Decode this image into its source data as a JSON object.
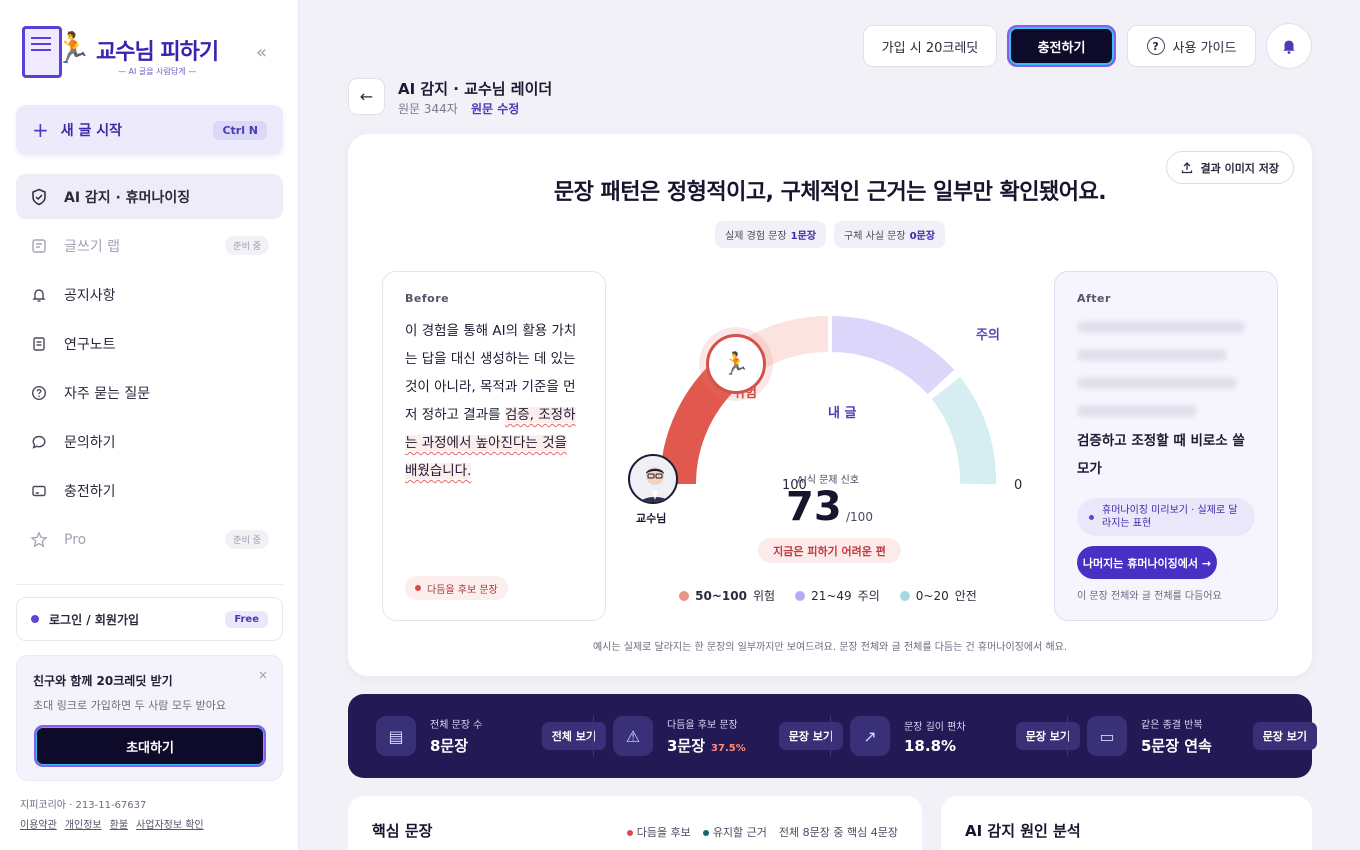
{
  "brand": {
    "title": "교수님 피하기",
    "subtitle": "— AI 글을 사람답게 —",
    "collapse": "«"
  },
  "new_doc": {
    "label": "새 글 시작",
    "shortcut": "Ctrl N"
  },
  "nav": [
    {
      "label": "AI 감지 · 휴머나이징",
      "icon": "shield-icon",
      "badge": ""
    },
    {
      "label": "글쓰기 랩",
      "icon": "document-icon",
      "badge": "준비 중"
    },
    {
      "label": "공지사항",
      "icon": "bell-icon",
      "badge": ""
    },
    {
      "label": "연구노트",
      "icon": "note-icon",
      "badge": ""
    },
    {
      "label": "자주 묻는 질문",
      "icon": "question-icon",
      "badge": ""
    },
    {
      "label": "문의하기",
      "icon": "chat-icon",
      "badge": ""
    },
    {
      "label": "충전하기",
      "icon": "card-icon",
      "badge": ""
    },
    {
      "label": "Pro",
      "icon": "star-icon",
      "badge": "준비 중"
    }
  ],
  "login": {
    "label": "로그인 / 회원가입",
    "badge": "Free"
  },
  "invite": {
    "title": "친구와 함께 20크레딧 받기",
    "desc": "초대 링크로 가입하면 두 사람 모두 받아요",
    "button": "초대하기",
    "close": "×"
  },
  "footer": {
    "company": "지피코리아 · 213-11-67637",
    "links": [
      "이용약관",
      "개인정보",
      "환불",
      "사업자정보 확인"
    ]
  },
  "topbar": {
    "credit": "가입 시 20크레딧",
    "charge": "충전하기",
    "guide": "사용 가이드",
    "guide_icon": "?"
  },
  "header": {
    "title": "AI 감지 · 교수님 레이더",
    "sub": "원문 344자",
    "edit": "원문 수정"
  },
  "result": {
    "save": "결과 이미지 저장",
    "headline": "문장 패턴은 정형적이고, 구체적인 근거는 일부만 확인됐어요.",
    "chips": [
      {
        "label": "실제 경험 문장",
        "value": "1문장"
      },
      {
        "label": "구체 사실 문장",
        "value": "0문장"
      }
    ],
    "before": {
      "heading": "Before",
      "text_plain": "이 경험을 통해 AI의 활용 가치는 답을 대신 생성하는 데 있는 것이 아니라, 목적과 기준을 먼저 정하고 결과를 ",
      "text_flag": "검증, 조정하는 과정에서 높아진다는 것을 배웠습니다.",
      "pill": "다듬을 후보 문장"
    },
    "after": {
      "heading": "After",
      "strong": "검증하고 조정할 때 비로소 쓸모가",
      "preview": "휴머나이징 미리보기 · 실제로 달라지는 표현",
      "button": "나머지는 휴머나이징에서 →",
      "note": "이 문장 전체와 글 전체를 다듬어요"
    },
    "gauge": {
      "label_danger": "위험",
      "label_caution": "주의",
      "label_safe": "안전",
      "label_me": "내 글",
      "label_prof": "교수님",
      "min_label": "0",
      "max_label": "100",
      "score_label": "AI식 문제 신호",
      "score": 73,
      "score_max": "/100",
      "status": "지금은 피하기 어려운 편",
      "colors": {
        "danger": "#e1584e",
        "caution": "#c9c0f5",
        "safe": "#cdebee"
      }
    },
    "legend": [
      {
        "range": "50~100",
        "label": "위험",
        "color": "#e89386"
      },
      {
        "range": "21~49",
        "label": "주의",
        "color": "#b7a9f5"
      },
      {
        "range": "0~20",
        "label": "안전",
        "color": "#a8d6df"
      }
    ],
    "footnote": "예시는 실제로 달라지는 한 문장의 일부까지만 보여드려요. 문장 전체와 글 전체를 다듬는 건 휴머나이징에서 해요."
  },
  "stats": [
    {
      "label": "전체 문장 수",
      "value": "8문장",
      "extra": "",
      "button": "전체 보기",
      "icon": "document-icon"
    },
    {
      "label": "다듬을 후보 문장",
      "value": "3문장",
      "extra": "37.5%",
      "button": "문장 보기",
      "icon": "warning-icon"
    },
    {
      "label": "문장 길이 편차",
      "value": "18.8%",
      "extra": "",
      "button": "문장 보기",
      "icon": "trend-icon"
    },
    {
      "label": "같은 종결 반복",
      "value": "5문장 연속",
      "extra": "",
      "button": "문장 보기",
      "icon": "message-icon"
    }
  ],
  "bottom": {
    "core_title": "핵심 문장",
    "legend_red": "다듬을 후보",
    "legend_teal": "유지할 근거",
    "count": "전체 8문장 중 핵심 4문장",
    "cause_title": "AI 감지 원인 분석"
  }
}
